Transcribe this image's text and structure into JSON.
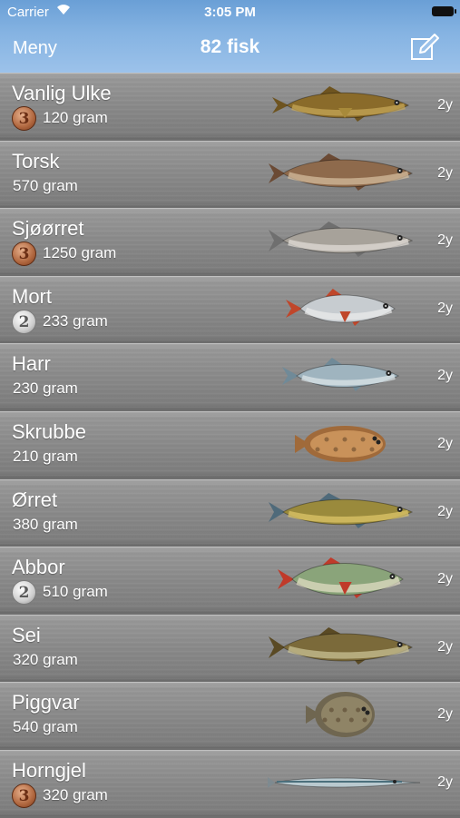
{
  "status_bar": {
    "carrier": "Carrier",
    "time": "3:05 PM"
  },
  "nav": {
    "menu_label": "Meny",
    "title": "82 fisk",
    "edit_icon": "compose-icon"
  },
  "colors": {
    "nav_bar": "#85b3e2",
    "row_bg": "#8a8a8a",
    "bronze": "#b0673f",
    "silver": "#cfcfcf"
  },
  "fish_list": [
    {
      "name": "Vanlig Ulke",
      "weight": "120 gram",
      "medal": "3",
      "medal_type": "bronze",
      "age": "2y",
      "icon": "sculpin-icon"
    },
    {
      "name": "Torsk",
      "weight": "570 gram",
      "medal": "",
      "medal_type": "",
      "age": "2y",
      "icon": "cod-icon"
    },
    {
      "name": "Sjøørret",
      "weight": "1250 gram",
      "medal": "3",
      "medal_type": "bronze",
      "age": "2y",
      "icon": "sea-trout-icon"
    },
    {
      "name": "Mort",
      "weight": "233 gram",
      "medal": "2",
      "medal_type": "silver",
      "age": "2y",
      "icon": "roach-icon"
    },
    {
      "name": "Harr",
      "weight": "230 gram",
      "medal": "",
      "medal_type": "",
      "age": "2y",
      "icon": "grayling-icon"
    },
    {
      "name": "Skrubbe",
      "weight": "210 gram",
      "medal": "",
      "medal_type": "",
      "age": "2y",
      "icon": "flounder-icon"
    },
    {
      "name": "Ørret",
      "weight": "380 gram",
      "medal": "",
      "medal_type": "",
      "age": "2y",
      "icon": "brown-trout-icon"
    },
    {
      "name": "Abbor",
      "weight": "510 gram",
      "medal": "2",
      "medal_type": "silver",
      "age": "2y",
      "icon": "perch-icon"
    },
    {
      "name": "Sei",
      "weight": "320 gram",
      "medal": "",
      "medal_type": "",
      "age": "2y",
      "icon": "pollock-icon"
    },
    {
      "name": "Piggvar",
      "weight": "540 gram",
      "medal": "",
      "medal_type": "",
      "age": "2y",
      "icon": "turbot-icon"
    },
    {
      "name": "Horngjel",
      "weight": "320 gram",
      "medal": "3",
      "medal_type": "bronze",
      "age": "2y",
      "icon": "garfish-icon"
    }
  ]
}
